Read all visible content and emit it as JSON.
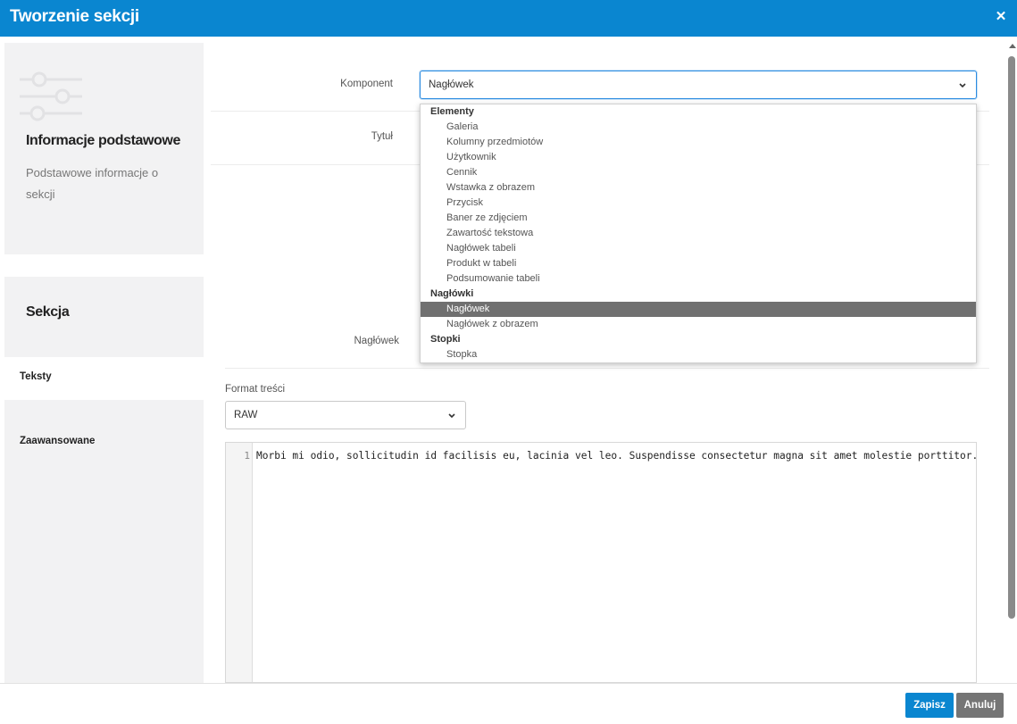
{
  "dialog": {
    "title": "Tworzenie sekcji",
    "close_icon": "close-icon",
    "accent_color": "#0a86d0"
  },
  "basic_info": {
    "icon": "sliders-icon",
    "heading": "Informacje podstawowe",
    "description": "Podstawowe informacje o sekcji"
  },
  "section": {
    "heading": "Sekcja",
    "tabs": [
      {
        "label": "Teksty",
        "active": true
      },
      {
        "label": "Zaawansowane",
        "active": false
      }
    ]
  },
  "form": {
    "component_label": "Komponent",
    "component_value": "Nagłówek",
    "title_label": "Tytuł",
    "heading_label": "Nagłówek",
    "format_label": "Format treści",
    "format_value": "RAW"
  },
  "dropdown": {
    "selected": "Nagłówek",
    "items": [
      {
        "type": "group",
        "label": "Elementy"
      },
      {
        "type": "option",
        "label": "Galeria"
      },
      {
        "type": "option",
        "label": "Kolumny przedmiotów"
      },
      {
        "type": "option",
        "label": "Użytkownik"
      },
      {
        "type": "option",
        "label": "Cennik"
      },
      {
        "type": "option",
        "label": "Wstawka z obrazem"
      },
      {
        "type": "option",
        "label": "Przycisk"
      },
      {
        "type": "option",
        "label": "Baner ze zdjęciem"
      },
      {
        "type": "option",
        "label": "Zawartość tekstowa"
      },
      {
        "type": "option",
        "label": "Nagłówek tabeli"
      },
      {
        "type": "option",
        "label": "Produkt w tabeli"
      },
      {
        "type": "option",
        "label": "Podsumowanie tabeli"
      },
      {
        "type": "group",
        "label": "Nagłówki"
      },
      {
        "type": "option",
        "label": "Nagłówek"
      },
      {
        "type": "option",
        "label": "Nagłówek z obrazem"
      },
      {
        "type": "group",
        "label": "Stopki"
      },
      {
        "type": "option",
        "label": "Stopka"
      }
    ]
  },
  "editor": {
    "line_number": "1",
    "content": "Morbi mi odio, sollicitudin id facilisis eu, lacinia vel leo. Suspendisse consectetur magna sit amet molestie porttitor."
  },
  "footer": {
    "save_label": "Zapisz",
    "cancel_label": "Anuluj",
    "save_color": "#0a86d0",
    "cancel_color": "#757575"
  }
}
